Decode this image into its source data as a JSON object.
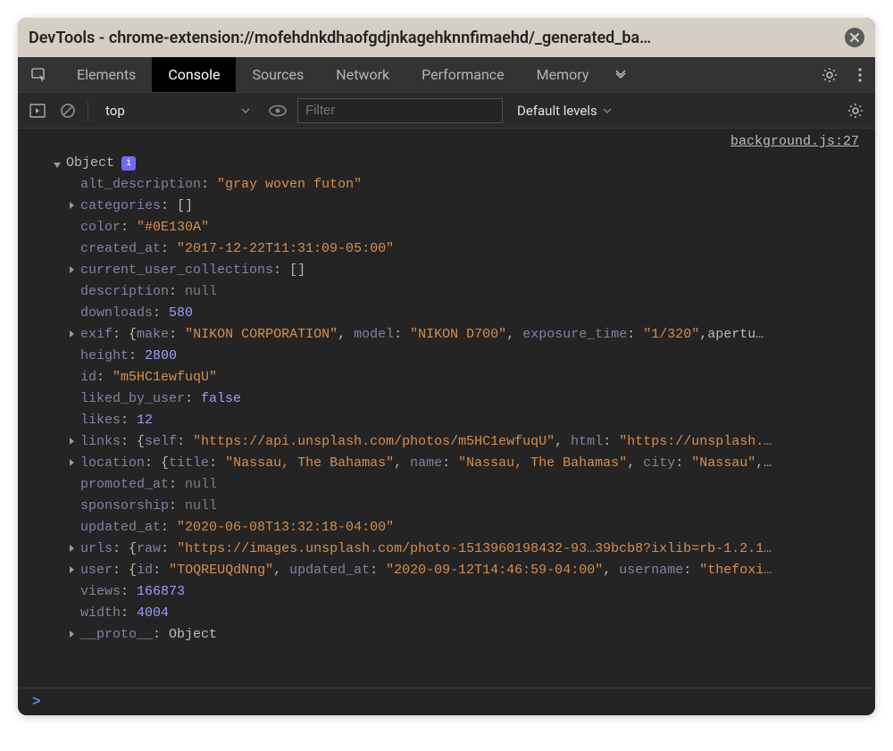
{
  "titlebar": {
    "title": "DevTools - chrome-extension://mofehdnkdhaofgdjnkagehknnfimaehd/_generated_ba…"
  },
  "tabs": {
    "items": [
      "Elements",
      "Console",
      "Sources",
      "Network",
      "Performance",
      "Memory"
    ],
    "active_index": 1
  },
  "toolbar": {
    "context": "top",
    "filter_placeholder": "Filter",
    "levels": "Default levels"
  },
  "source_link": "background.js:27",
  "object": {
    "label": "Object",
    "info_badge": "i",
    "props": {
      "alt_description": {
        "type": "string",
        "value": "gray woven futon",
        "expandable": false
      },
      "categories": {
        "type": "array",
        "value": "[]",
        "expandable": true
      },
      "color": {
        "type": "string",
        "value": "#0E130A",
        "expandable": false
      },
      "created_at": {
        "type": "string",
        "value": "2017-12-22T11:31:09-05:00",
        "expandable": false
      },
      "current_user_collections": {
        "type": "array",
        "value": "[]",
        "expandable": true
      },
      "description": {
        "type": "null",
        "value": "null",
        "expandable": false
      },
      "downloads": {
        "type": "number",
        "value": "580",
        "expandable": false
      },
      "exif": {
        "type": "object",
        "expandable": true,
        "inline": [
          {
            "k": "make",
            "v": "\"NIKON CORPORATION\"",
            "t": "string"
          },
          {
            "k": "model",
            "v": "\"NIKON D700\"",
            "t": "string"
          },
          {
            "k": "exposure_time",
            "v": "\"1/320\"",
            "t": "string"
          },
          {
            "k": "apertu…",
            "v": "",
            "t": "truncated"
          }
        ]
      },
      "height": {
        "type": "number",
        "value": "2800",
        "expandable": false
      },
      "id": {
        "type": "string",
        "value": "m5HC1ewfuqU",
        "expandable": false
      },
      "liked_by_user": {
        "type": "bool",
        "value": "false",
        "expandable": false
      },
      "likes": {
        "type": "number",
        "value": "12",
        "expandable": false
      },
      "links": {
        "type": "object",
        "expandable": true,
        "inline": [
          {
            "k": "self",
            "v": "\"https://api.unsplash.com/photos/m5HC1ewfuqU\"",
            "t": "string"
          },
          {
            "k": "html",
            "v": "\"https://unsplash.…",
            "t": "string"
          }
        ]
      },
      "location": {
        "type": "object",
        "expandable": true,
        "inline": [
          {
            "k": "title",
            "v": "\"Nassau, The Bahamas\"",
            "t": "string"
          },
          {
            "k": "name",
            "v": "\"Nassau, The Bahamas\"",
            "t": "string"
          },
          {
            "k": "city",
            "v": "\"Nassau\"",
            "t": "string"
          },
          {
            "k": "…",
            "v": "",
            "t": "truncated"
          }
        ]
      },
      "promoted_at": {
        "type": "null",
        "value": "null",
        "expandable": false
      },
      "sponsorship": {
        "type": "null",
        "value": "null",
        "expandable": false
      },
      "updated_at": {
        "type": "string",
        "value": "2020-06-08T13:32:18-04:00",
        "expandable": false
      },
      "urls": {
        "type": "object",
        "expandable": true,
        "inline": [
          {
            "k": "raw",
            "v": "\"https://images.unsplash.com/photo-1513960198432-93…39bcb8?ixlib=rb-1.2.1…",
            "t": "string"
          }
        ]
      },
      "user": {
        "type": "object",
        "expandable": true,
        "inline": [
          {
            "k": "id",
            "v": "\"TOQREUQdNng\"",
            "t": "string"
          },
          {
            "k": "updated_at",
            "v": "\"2020-09-12T14:46:59-04:00\"",
            "t": "string"
          },
          {
            "k": "username",
            "v": "\"thefoxi…",
            "t": "string"
          }
        ]
      },
      "views": {
        "type": "number",
        "value": "166873",
        "expandable": false
      },
      "width": {
        "type": "number",
        "value": "4004",
        "expandable": false
      },
      "__proto__": {
        "type": "proto",
        "value": "Object",
        "expandable": true
      }
    }
  },
  "prompt": ">"
}
